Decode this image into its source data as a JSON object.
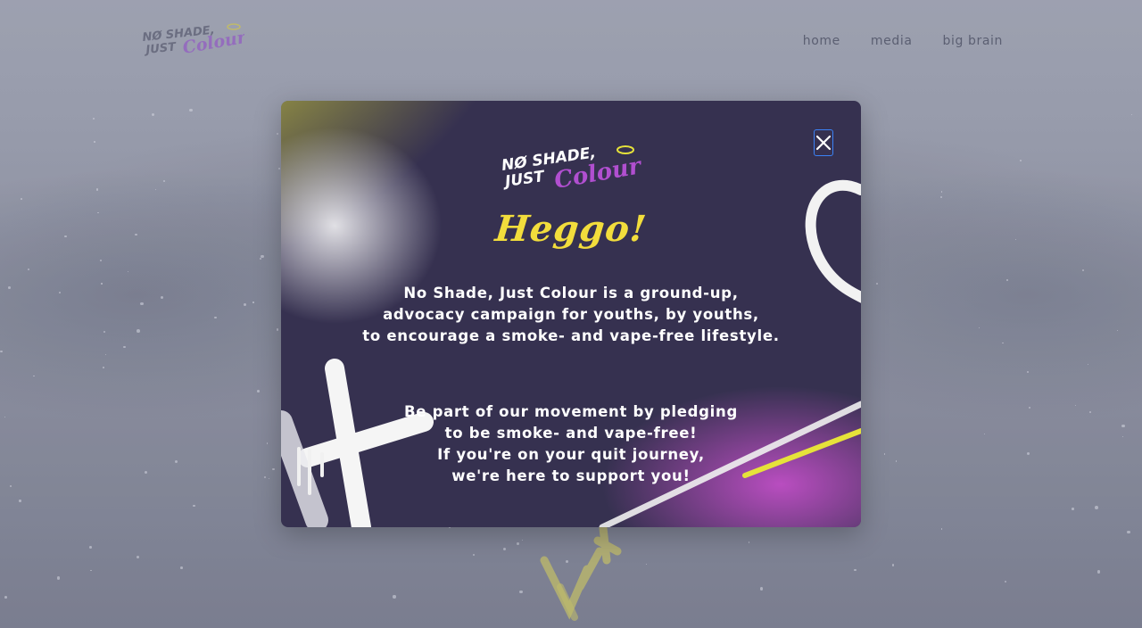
{
  "site": {
    "logo_text": "NO SHADE, JUST COLOUR"
  },
  "nav": {
    "items": [
      {
        "label": "home"
      },
      {
        "label": "media"
      },
      {
        "label": "big brain"
      }
    ]
  },
  "modal": {
    "logo_text": "NO SHADE, JUST COLOUR",
    "greeting": "Heggo!",
    "paragraph1": [
      "No Shade, Just Colour is a ground-up,",
      "advocacy campaign for youths, by youths,",
      "to encourage a smoke- and vape-free lifestyle."
    ],
    "paragraph2": [
      "Be part of our movement by pledging",
      "to be smoke- and vape-free!",
      "If you're on your quit journey,",
      "we're here to support you!"
    ],
    "close_icon": "close-icon"
  },
  "colors": {
    "accent_yellow": "#f2dd3c",
    "modal_bg": "#363150",
    "accent_purple": "#b14fd0",
    "nav_text": "#5c6072",
    "focus_blue": "#3b82f6"
  }
}
